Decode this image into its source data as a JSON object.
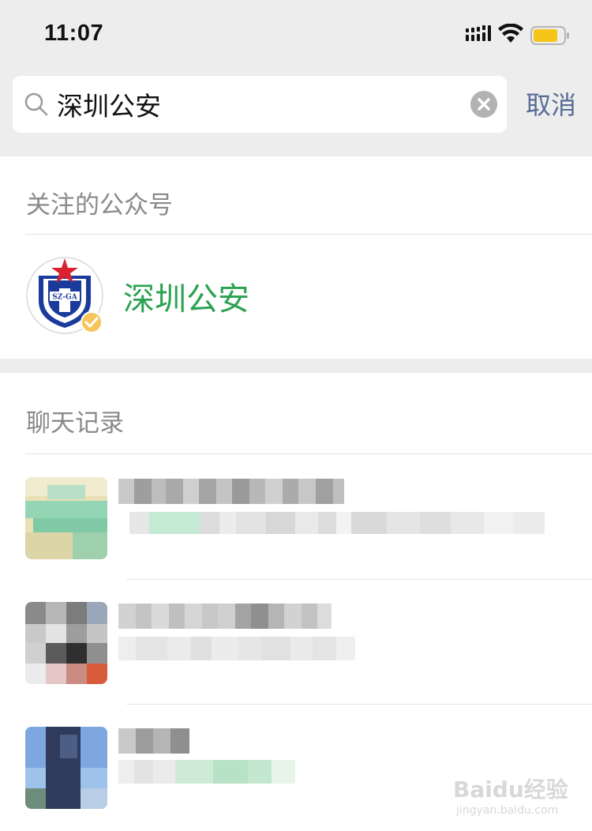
{
  "status_bar": {
    "time": "11:07",
    "battery_color": "#f5c518"
  },
  "search": {
    "query": "深圳公安",
    "cancel_label": "取消"
  },
  "official_accounts": {
    "section_title": "关注的公众号",
    "items": [
      {
        "name": "深圳公安",
        "logo_text": "SZ-GA",
        "verified": true
      }
    ]
  },
  "chat_history": {
    "section_title": "聊天记录",
    "items": [
      {
        "avatar": "pixelated-avatar",
        "name_obscured": true,
        "message_obscured": true
      },
      {
        "avatar": "pixelated-avatar",
        "name_obscured": true,
        "message_obscured": true
      },
      {
        "avatar": "pixelated-avatar",
        "name_obscured": true,
        "message_obscured": true
      }
    ]
  },
  "watermark": {
    "brand": "Baidu经验",
    "url": "jingyan.baidu.com"
  },
  "colors": {
    "accent_green": "#2aa251",
    "link_blue": "#576b95",
    "background": "#ededed"
  }
}
